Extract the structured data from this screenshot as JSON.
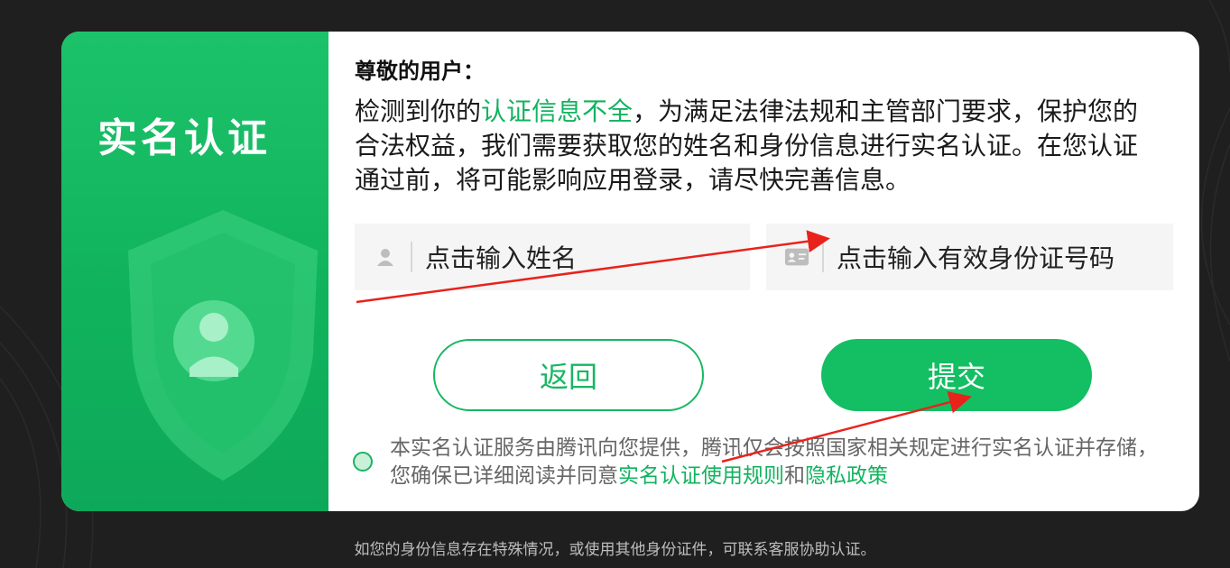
{
  "left_panel": {
    "title": "实名认证"
  },
  "greeting": "尊敬的用户：",
  "description": {
    "prefix": "检测到你的",
    "highlight": "认证信息不全",
    "suffix": "，为满足法律法规和主管部门要求，保护您的合法权益，我们需要获取您的姓名和身份信息进行实名认证。在您认证通过前，将可能影响应用登录，请尽快完善信息。"
  },
  "fields": {
    "name_placeholder": "点击输入姓名",
    "id_placeholder": "点击输入有效身份证号码"
  },
  "buttons": {
    "back": "返回",
    "submit": "提交"
  },
  "agreement": {
    "text": "本实名认证服务由腾讯向您提供，腾讯仅会按照国家相关规定进行实名认证并存储，您确保已详细阅读并同意",
    "rules_link": "实名认证使用规则",
    "and": "和",
    "privacy_link": "隐私政策"
  },
  "footer": "如您的身份信息存在特殊情况，或使用其他身份证件，可联系客服协助认证。",
  "colors": {
    "accent": "#14be63",
    "background": "#1f1f1f",
    "annotation": "#e8231b"
  },
  "icons": [
    "user-icon",
    "id-card-icon",
    "shield-icon"
  ]
}
